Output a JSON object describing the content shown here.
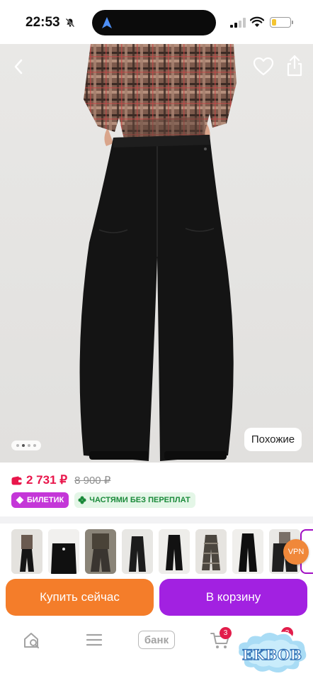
{
  "status_bar": {
    "time": "22:53",
    "battery_level_percent": 25,
    "icons": [
      "bell-muted-icon",
      "navigation-arrow-icon",
      "signal-icon",
      "wifi-icon",
      "battery-icon"
    ]
  },
  "header": {
    "icons": [
      "back-chevron-icon",
      "heart-icon",
      "share-icon"
    ]
  },
  "gallery": {
    "similar_label": "Похожие",
    "page_indicator": {
      "total": 4,
      "active": 2
    }
  },
  "price": {
    "current": "2 731 ₽",
    "old": "8 900 ₽",
    "icon": "wallet-icon"
  },
  "badges": {
    "ticket": "БИЛЕТИК",
    "installments": "ЧАСТЯМИ БЕЗ ПЕРЕПЛАТ"
  },
  "thumbnails": [
    {
      "name": "variant-1"
    },
    {
      "name": "variant-2"
    },
    {
      "name": "variant-3"
    },
    {
      "name": "variant-4"
    },
    {
      "name": "variant-5"
    },
    {
      "name": "variant-6"
    },
    {
      "name": "variant-7"
    },
    {
      "name": "variant-8"
    }
  ],
  "vpn_label": "VPN",
  "actions": {
    "buy_now": "Купить сейчас",
    "add_to_cart": "В корзину"
  },
  "bottom_nav": {
    "bank_label": "банк",
    "cart_count": "3",
    "profile_count": "2",
    "icons": [
      "home-search-icon",
      "catalog-icon",
      "bank-icon",
      "cart-icon",
      "profile-icon"
    ]
  },
  "watermark_text": "EKBOB",
  "colors": {
    "price": "#e9164b",
    "buy_button": "#f47d2a",
    "cart_button": "#a221e1",
    "ticket_badge": "#c437d8",
    "installments_badge_text": "#1a8a3a",
    "nav_badge": "#e21d4b"
  }
}
